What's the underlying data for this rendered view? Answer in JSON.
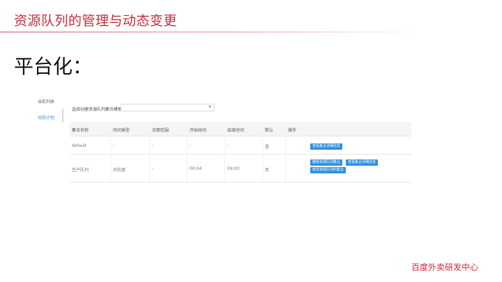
{
  "slide": {
    "title": "资源队列的管理与动态变更",
    "heading": "平台化：",
    "footer": "百度外卖研发中心"
  },
  "sidebar": {
    "items": [
      {
        "label": "当前列表"
      },
      {
        "label": "动态计划"
      }
    ]
  },
  "filter": {
    "label": "选择创建资源队列集合模板:",
    "value": ""
  },
  "table": {
    "headers": [
      "集合名称",
      "时间类型",
      "日期范围",
      "开始时间",
      "结束时间",
      "默认",
      "操作"
    ],
    "rows": [
      {
        "cells": [
          "default",
          "-",
          "-",
          "-",
          "-",
          "是"
        ],
        "actions": [
          "查看集合详细信息"
        ]
      },
      {
        "cells": [
          "生产队列",
          "天粒度",
          "-",
          "00:04",
          "09:00",
          "否"
        ],
        "actions": [
          "删除资源队列集合",
          "查看集合详细信息",
          "修改资源队列的集合"
        ]
      }
    ]
  },
  "colors": {
    "accent_red": "#cc2a3b",
    "button_blue": "#2f8fdf",
    "active_blue": "#3a8ee6"
  }
}
